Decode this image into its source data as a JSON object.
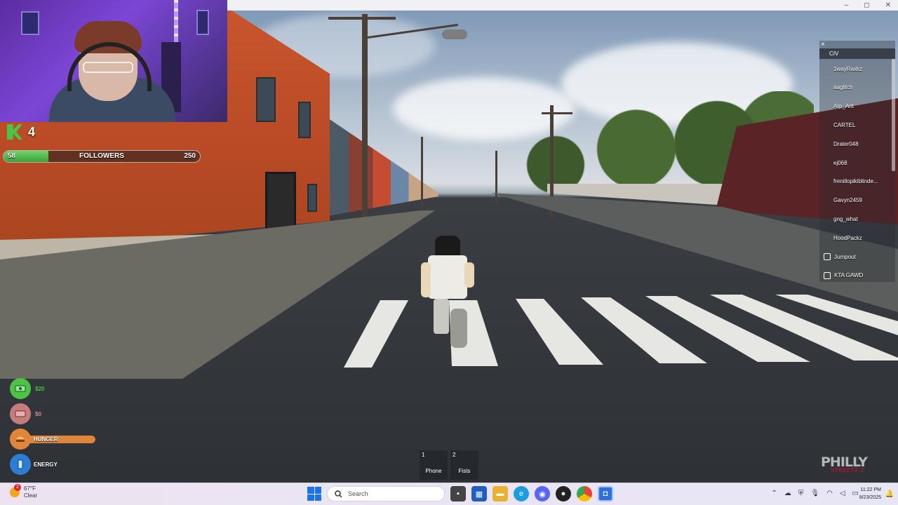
{
  "hud": {
    "k_count": "4",
    "followers": {
      "current": "58",
      "label": "FOLLOWERS",
      "max": "250",
      "fill_fraction": 0.23
    },
    "stats": {
      "cash": "$20",
      "bank": "$0",
      "hunger_label": "HUNGER",
      "hunger_fraction": 1.0,
      "energy_label": "ENERGY",
      "energy_fraction": 0.0
    },
    "hotbar": [
      {
        "num": "1",
        "label": "Phone"
      },
      {
        "num": "2",
        "label": "Fists"
      }
    ],
    "logo": {
      "main": "PHILLY",
      "sub": "STREETZ 2"
    }
  },
  "player_list": {
    "close": "×",
    "team": "CIV",
    "players": [
      {
        "name": "1wayRaxkz",
        "premium": false
      },
      {
        "name": "aaglitch",
        "premium": false
      },
      {
        "name": "Arp_Ant",
        "premium": false
      },
      {
        "name": "CARTEL",
        "premium": false
      },
      {
        "name": "Drater048",
        "premium": false
      },
      {
        "name": "ej068",
        "premium": false
      },
      {
        "name": "frenillopikiblinde...",
        "premium": false
      },
      {
        "name": "Gavyn2459",
        "premium": false
      },
      {
        "name": "gng_what",
        "premium": false
      },
      {
        "name": "HoodPackz",
        "premium": false
      },
      {
        "name": "Jumpout",
        "premium": true
      },
      {
        "name": "KTA GAWD",
        "premium": true
      }
    ]
  },
  "window_controls": {
    "minimize": "–",
    "maximize": "◻",
    "close": "✕"
  },
  "taskbar": {
    "weather_badge": "2",
    "temperature": "67°F",
    "condition": "Clear",
    "search_placeholder": "Search",
    "time": "11:22 PM",
    "date": "8/23/2025"
  },
  "colors": {
    "followers_fill": "#3aa337",
    "hunger": "#e0863a",
    "cash": "#4cc247",
    "bank": "#d08a8a",
    "energy": "#2a7fd4",
    "taskbar": "#ece4f2"
  }
}
